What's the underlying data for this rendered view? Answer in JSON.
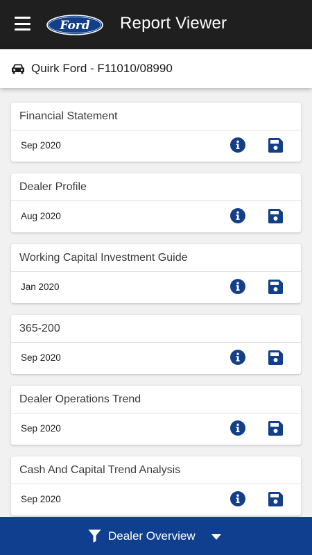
{
  "header": {
    "title": "Report Viewer",
    "logo_text": "Ford",
    "menu_icon": "hamburger-menu-icon"
  },
  "dealer": {
    "icon": "car-icon",
    "name": "Quirk Ford - F11010/08990"
  },
  "reports": [
    {
      "title": "Financial Statement",
      "date": "Sep 2020"
    },
    {
      "title": "Dealer Profile",
      "date": "Aug 2020"
    },
    {
      "title": "Working Capital Investment Guide",
      "date": "Jan 2020"
    },
    {
      "title": "365-200",
      "date": "Sep 2020"
    },
    {
      "title": "Dealer Operations Trend",
      "date": "Sep 2020"
    },
    {
      "title": "Cash And Capital Trend Analysis",
      "date": "Sep 2020"
    }
  ],
  "bottom_bar": {
    "label": "Dealer Overview",
    "icon": "filter-icon",
    "dropdown_icon": "chevron-down-icon"
  },
  "colors": {
    "appbar": "#1f1f1f",
    "accent_blue": "#0f3f8e",
    "icon_blue": "#123f87",
    "background": "#f1f1f1"
  }
}
